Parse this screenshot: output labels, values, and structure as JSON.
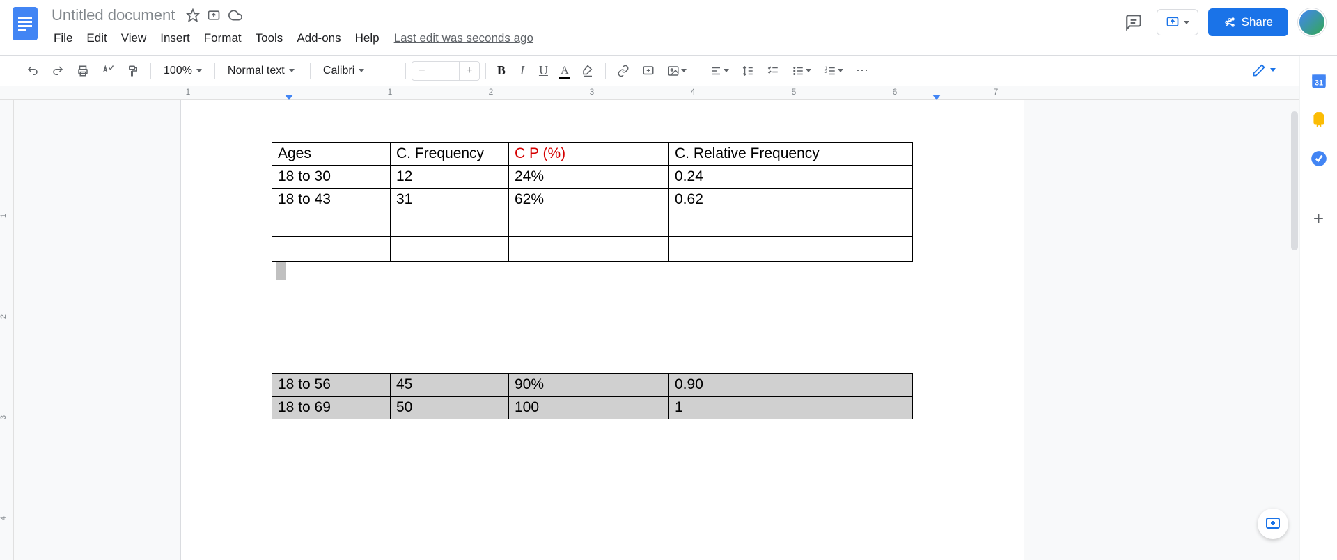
{
  "doc": {
    "title": "Untitled document"
  },
  "menu": {
    "file": "File",
    "edit": "Edit",
    "view": "View",
    "insert": "Insert",
    "format": "Format",
    "tools": "Tools",
    "addons": "Add-ons",
    "help": "Help",
    "last_edit": "Last edit was seconds ago"
  },
  "share": {
    "label": "Share"
  },
  "toolbar": {
    "zoom": "100%",
    "style": "Normal text",
    "font": "Calibri",
    "more": "⋯"
  },
  "ruler": {
    "marks": [
      "1",
      "1",
      "2",
      "3",
      "4",
      "5",
      "6",
      "7"
    ]
  },
  "table1": {
    "headers": {
      "ages": "Ages",
      "cf": "C. Frequency",
      "cp": "C P (%)",
      "crf": "C. Relative Frequency"
    },
    "rows": [
      {
        "ages": "18 to 30",
        "cf": "12",
        "cp": "24%",
        "crf": "0.24"
      },
      {
        "ages": "18 to 43",
        "cf": "31",
        "cp": "62%",
        "crf": "0.62"
      }
    ]
  },
  "table2": {
    "rows": [
      {
        "ages": "18 to 56",
        "cf": "45",
        "cp": "90%",
        "crf": "0.90"
      },
      {
        "ages": "18 to 69",
        "cf": "50",
        "cp": "100",
        "crf": "1"
      }
    ]
  },
  "sidebar": {
    "calendar_day": "31"
  }
}
